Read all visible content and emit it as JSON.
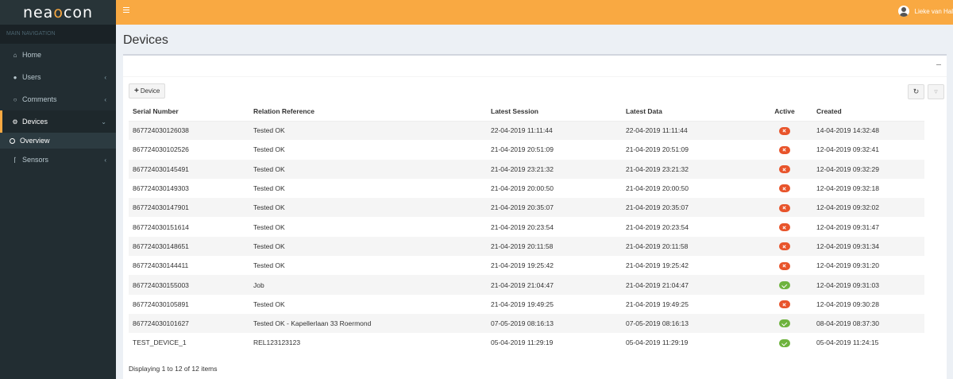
{
  "brand": {
    "logo_pre": "nea",
    "logo_accent": "o",
    "logo_post": "con"
  },
  "sidebar": {
    "header": "MAIN NAVIGATION",
    "items": [
      {
        "label": "Home",
        "icon": "home-icon"
      },
      {
        "label": "Users",
        "icon": "user-icon"
      },
      {
        "label": "Comments",
        "icon": "comment-icon"
      },
      {
        "label": "Devices",
        "icon": "gear-icon"
      },
      {
        "label": "Sensors",
        "icon": "thermometer-icon"
      }
    ],
    "sub_item": "Overview"
  },
  "header": {
    "user_name": "Lieke van Hal"
  },
  "page": {
    "title": "Devices"
  },
  "toolbar": {
    "add_label": "Device"
  },
  "table": {
    "columns": [
      "Serial Number",
      "Relation Reference",
      "Latest Session",
      "Latest Data",
      "Active",
      "Created"
    ],
    "rows": [
      {
        "serial": "867724030126038",
        "relation": "Tested OK",
        "session": "22-04-2019 11:11:44",
        "data": "22-04-2019 11:11:44",
        "active": false,
        "created": "14-04-2019 14:32:48"
      },
      {
        "serial": "867724030102526",
        "relation": "Tested OK",
        "session": "21-04-2019 20:51:09",
        "data": "21-04-2019 20:51:09",
        "active": false,
        "created": "12-04-2019 09:32:41"
      },
      {
        "serial": "867724030145491",
        "relation": "Tested OK",
        "session": "21-04-2019 23:21:32",
        "data": "21-04-2019 23:21:32",
        "active": false,
        "created": "12-04-2019 09:32:29"
      },
      {
        "serial": "867724030149303",
        "relation": "Tested OK",
        "session": "21-04-2019 20:00:50",
        "data": "21-04-2019 20:00:50",
        "active": false,
        "created": "12-04-2019 09:32:18"
      },
      {
        "serial": "867724030147901",
        "relation": "Tested OK",
        "session": "21-04-2019 20:35:07",
        "data": "21-04-2019 20:35:07",
        "active": false,
        "created": "12-04-2019 09:32:02"
      },
      {
        "serial": "867724030151614",
        "relation": "Tested OK",
        "session": "21-04-2019 20:23:54",
        "data": "21-04-2019 20:23:54",
        "active": false,
        "created": "12-04-2019 09:31:47"
      },
      {
        "serial": "867724030148651",
        "relation": "Tested OK",
        "session": "21-04-2019 20:11:58",
        "data": "21-04-2019 20:11:58",
        "active": false,
        "created": "12-04-2019 09:31:34"
      },
      {
        "serial": "867724030144411",
        "relation": "Tested OK",
        "session": "21-04-2019 19:25:42",
        "data": "21-04-2019 19:25:42",
        "active": false,
        "created": "12-04-2019 09:31:20"
      },
      {
        "serial": "867724030155003",
        "relation": "Job",
        "session": "21-04-2019 21:04:47",
        "data": "21-04-2019 21:04:47",
        "active": true,
        "created": "12-04-2019 09:31:03"
      },
      {
        "serial": "867724030105891",
        "relation": "Tested OK",
        "session": "21-04-2019 19:49:25",
        "data": "21-04-2019 19:49:25",
        "active": false,
        "created": "12-04-2019 09:30:28"
      },
      {
        "serial": "867724030101627",
        "relation": "Tested OK - Kapellerlaan 33 Roermond",
        "session": "07-05-2019 08:16:13",
        "data": "07-05-2019 08:16:13",
        "active": true,
        "created": "08-04-2019 08:37:30"
      },
      {
        "serial": "TEST_DEVICE_1",
        "relation": "REL123123123",
        "session": "05-04-2019 11:29:19",
        "data": "05-04-2019 11:29:19",
        "active": true,
        "created": "05-04-2019 11:24:15"
      }
    ]
  },
  "footer": {
    "summary": "Displaying 1 to 12 of 12 items"
  },
  "colors": {
    "accent": "#f9a942",
    "sidebar": "#222d32",
    "inactive": "#e8542b",
    "active": "#6eb33e"
  }
}
